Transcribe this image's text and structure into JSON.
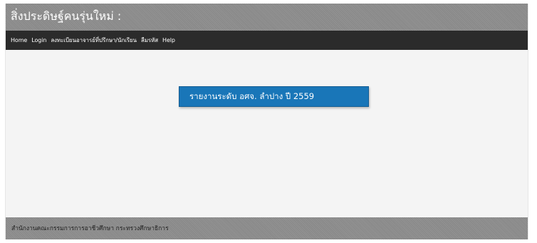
{
  "header": {
    "site_title": "สิ่งประดิษฐ์คนรุ่นใหม่ :"
  },
  "nav": {
    "items": [
      {
        "label": "Home"
      },
      {
        "label": "Login"
      },
      {
        "label": "ลงทะเบียนอาจารย์ที่ปรึกษา/นักเรียน"
      },
      {
        "label": "ลืมรหัส"
      },
      {
        "label": "Help"
      }
    ]
  },
  "main": {
    "report_button_label": "รายงานระดับ อศจ. ลำปาง ปี 2559"
  },
  "footer": {
    "text": "สำนักงานคณะกรรมการการอาชีวศึกษา กระทรวงศึกษาธิการ"
  },
  "colors": {
    "header_bg": "#8e8e8e",
    "nav_bg": "#2b2b2b",
    "content_bg": "#f4f4f4",
    "button_bg": "#1976b8",
    "footer_bg": "#8e8e8e"
  }
}
